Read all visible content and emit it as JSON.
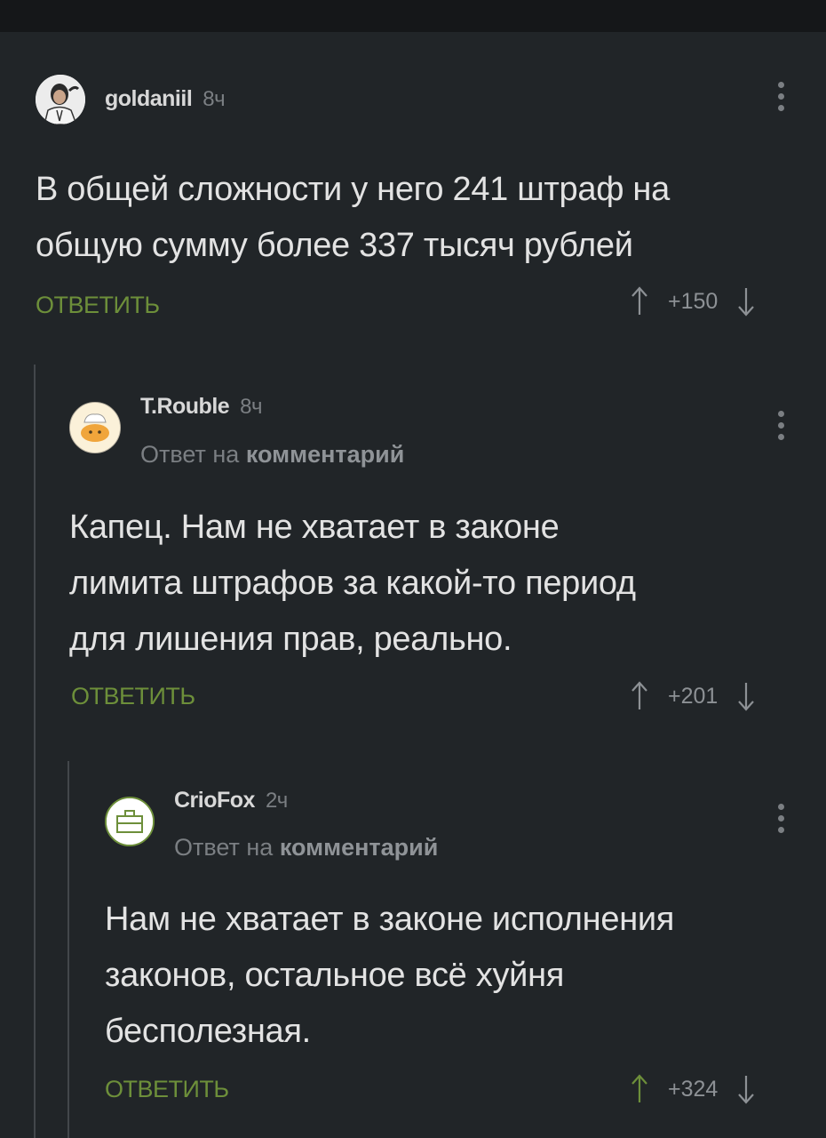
{
  "comments": [
    {
      "author": "goldaniil",
      "time": "8ч",
      "reply_to": null,
      "lines": [
        "В общей сложности у него 241 штраф на",
        "общую сумму более 337 тысяч рублей"
      ],
      "reply_label": "ОТВЕТИТЬ",
      "rating": "+150"
    },
    {
      "author": "T.Rouble",
      "time": "8ч",
      "reply_to": {
        "prefix": "Ответ на",
        "link": "комментарий"
      },
      "lines": [
        "Капец. Нам не хватает в законе",
        "лимита штрафов за какой-то период",
        "для лишения прав, реально."
      ],
      "reply_label": "ОТВЕТИТЬ",
      "rating": "+201"
    },
    {
      "author": "CrioFox",
      "time": "2ч",
      "reply_to": {
        "prefix": "Ответ на",
        "link": "комментарий"
      },
      "lines": [
        "Нам не хватает в законе исполнения",
        "законов, остальное всё хуйня",
        "бесполезная."
      ],
      "reply_label": "ОТВЕТИТЬ",
      "rating": "+324"
    }
  ],
  "colors": {
    "background": "#212528",
    "accent": "#6d8f3a",
    "muted": "#7b7f83",
    "upvoted": "#6d8f3a"
  },
  "icons": {
    "menu": "vertical-dots-icon",
    "up": "arrow-up-icon",
    "down": "arrow-down-icon"
  }
}
